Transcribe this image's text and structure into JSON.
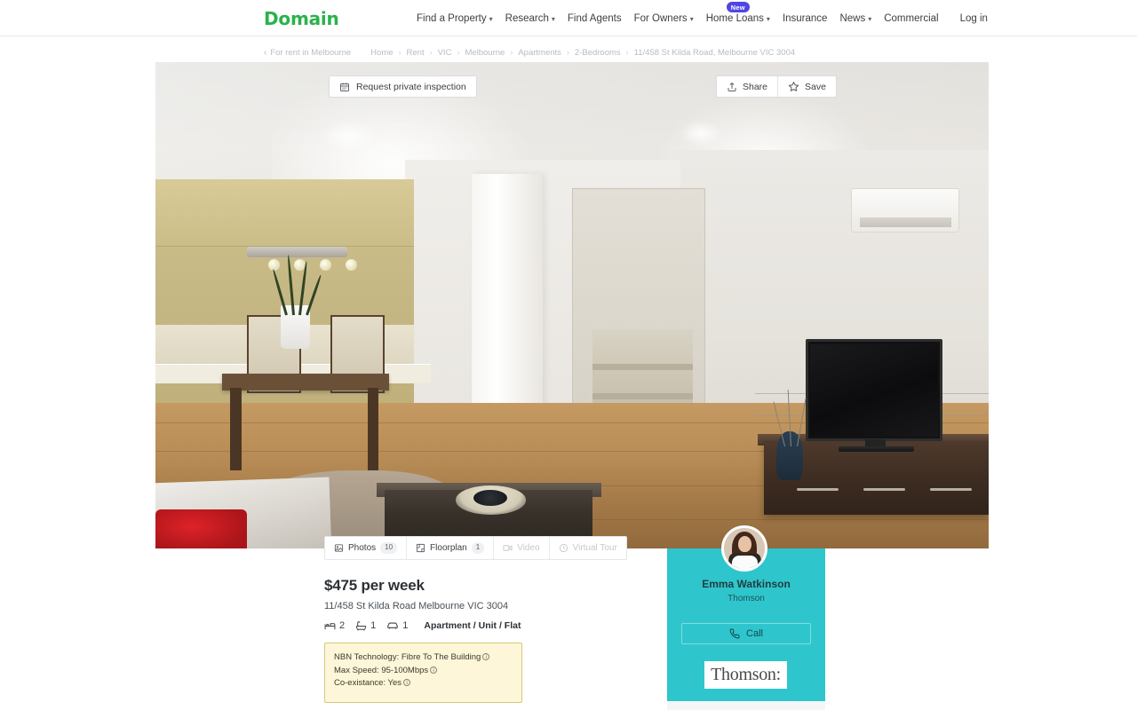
{
  "header": {
    "logo": "Domain",
    "logo_color": "#2bb24c",
    "nav": [
      {
        "label": "Find a Property",
        "caret": true,
        "badge": null
      },
      {
        "label": "Research",
        "caret": true,
        "badge": null
      },
      {
        "label": "Find Agents",
        "caret": false,
        "badge": null
      },
      {
        "label": "For Owners",
        "caret": true,
        "badge": null
      },
      {
        "label": "Home Loans",
        "caret": true,
        "badge": "New"
      },
      {
        "label": "Insurance",
        "caret": false,
        "badge": null
      },
      {
        "label": "News",
        "caret": true,
        "badge": null
      },
      {
        "label": "Commercial",
        "caret": false,
        "badge": null
      }
    ],
    "login_label": "Log in",
    "badge_color": "#4f46e5"
  },
  "breadcrumb": {
    "back_label": "For rent in Melbourne",
    "items": [
      "Home",
      "Rent",
      "VIC",
      "Melbourne",
      "Apartments",
      "2-Bedrooms",
      "11/458 St Kilda Road, Melbourne VIC 3004"
    ],
    "separator": "›"
  },
  "hero": {
    "request_inspection_label": "Request private inspection",
    "share_label": "Share",
    "save_label": "Save",
    "alt": "Open plan living and dining room with kitchen, timber floors and wall mounted television"
  },
  "media_tabs": [
    {
      "label": "Photos",
      "count": "10",
      "disabled": false,
      "icon": "photo-icon"
    },
    {
      "label": "Floorplan",
      "count": "1",
      "disabled": false,
      "icon": "floorplan-icon"
    },
    {
      "label": "Video",
      "count": null,
      "disabled": true,
      "icon": "video-icon"
    },
    {
      "label": "Virtual Tour",
      "count": null,
      "disabled": true,
      "icon": "virtual-tour-icon"
    }
  ],
  "listing": {
    "price": "$475 per week",
    "address": "11/458 St Kilda Road Melbourne VIC 3004",
    "features": [
      {
        "icon": "bed-icon",
        "value": "2"
      },
      {
        "icon": "bath-icon",
        "value": "1"
      },
      {
        "icon": "car-icon",
        "value": "1"
      }
    ],
    "property_type": "Apartment / Unit / Flat"
  },
  "nbn": {
    "lines": [
      "NBN Technology: Fibre To The Building",
      "Max Speed: 95-100Mbps",
      "Co-existance: Yes"
    ],
    "background_color": "#fdf6d9",
    "border_color": "#d9c87a"
  },
  "agent": {
    "name": "Emma Watkinson",
    "agency": "Thomson",
    "call_label": "Call",
    "agency_logo_text": "Thomson:",
    "card_color": "#2ec6cc"
  }
}
